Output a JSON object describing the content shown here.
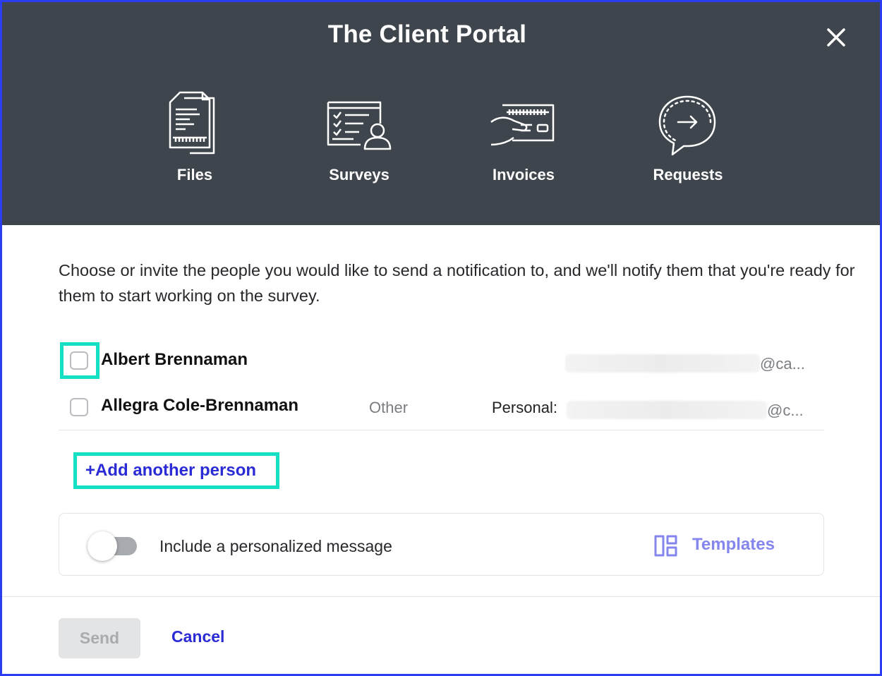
{
  "header": {
    "title": "The Client Portal",
    "features": [
      {
        "label": "Files",
        "icon": "files-icon"
      },
      {
        "label": "Surveys",
        "icon": "surveys-icon"
      },
      {
        "label": "Invoices",
        "icon": "invoices-icon"
      },
      {
        "label": "Requests",
        "icon": "requests-icon"
      }
    ]
  },
  "instructions": "Choose or invite the people you would like to send a notification to, and we'll notify them that you're ready for them to start working on the survey.",
  "people": [
    {
      "name": "Albert Brennaman",
      "role": "",
      "email_label": "",
      "email_suffix": "@ca...",
      "checked": false,
      "focused": true
    },
    {
      "name": "Allegra Cole-Brennaman",
      "role": "Other",
      "email_label": "Personal:",
      "email_suffix": "@c...",
      "checked": false,
      "focused": false
    }
  ],
  "add_person_label": "+Add another person",
  "message": {
    "toggle_on": false,
    "label": "Include a personalized message",
    "templates_label": "Templates"
  },
  "footer": {
    "send_label": "Send",
    "send_enabled": false,
    "cancel_label": "Cancel"
  },
  "colors": {
    "header_bg": "#3f454c",
    "accent": "#2b2bd6",
    "focus": "#16e0c4",
    "templates": "#8585ee"
  }
}
